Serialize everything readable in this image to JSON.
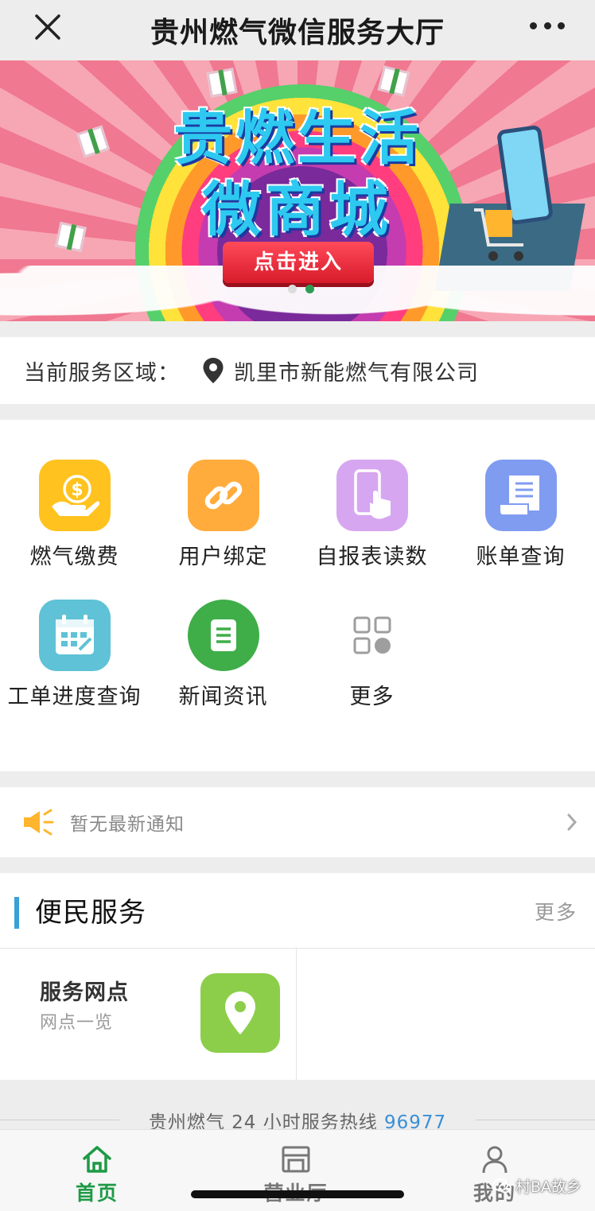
{
  "header": {
    "title": "贵州燃气微信服务大厅"
  },
  "banner": {
    "line1": "贵燃生活",
    "line2": "微商城",
    "cta": "点击进入",
    "active_dot": 1
  },
  "region": {
    "label": "当前服务区域：",
    "value": "凯里市新能燃气有限公司"
  },
  "services": [
    {
      "label": "燃气缴费",
      "icon": "coin-hand-icon",
      "color": "#ffc21e"
    },
    {
      "label": "用户绑定",
      "icon": "link-icon",
      "color": "#ffac3d"
    },
    {
      "label": "自报表读数",
      "icon": "phone-touch-icon",
      "color": "#d6a6f0"
    },
    {
      "label": "账单查询",
      "icon": "receipt-icon",
      "color": "#7f9cf0"
    },
    {
      "label": "工单进度查询",
      "icon": "calendar-icon",
      "color": "#5fc2d6"
    },
    {
      "label": "新闻资讯",
      "icon": "news-icon",
      "color": "#3fae48"
    },
    {
      "label": "更多",
      "icon": "more-grid-icon",
      "color": "#9e9e9e"
    }
  ],
  "notice": {
    "text": "暂无最新通知"
  },
  "convenience": {
    "title": "便民服务",
    "more": "更多",
    "cards": [
      {
        "title": "服务网点",
        "subtitle": "网点一览",
        "icon": "map-pin-icon",
        "color": "#8cce4a"
      }
    ]
  },
  "hotline": {
    "prefix": "贵州燃气 24 小时服务热线",
    "number": "96977"
  },
  "nav": {
    "items": [
      {
        "label": "首页",
        "icon": "home-icon",
        "active": true
      },
      {
        "label": "营业厅",
        "icon": "store-icon",
        "active": false
      },
      {
        "label": "我的",
        "icon": "user-icon",
        "active": false
      }
    ]
  },
  "watermark": "村BA故乡"
}
